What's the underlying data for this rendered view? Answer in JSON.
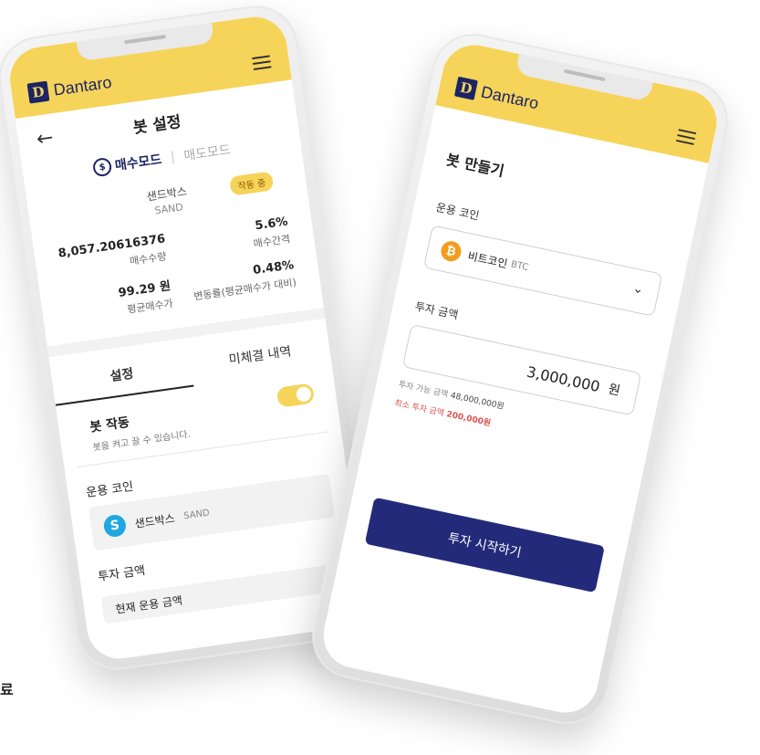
{
  "brand": {
    "name": "Dantaro",
    "mark": "D"
  },
  "left_phone": {
    "title": "봇 설정",
    "mode_active": "매수모드",
    "mode_inactive": "매도모드",
    "coin_name": "샌드박스",
    "coin_symbol": "SAND",
    "status_badge": "작동 중",
    "stats": [
      {
        "value": "8,057.20616376",
        "label": "매수수량"
      },
      {
        "value": "5.6%",
        "label": "매수간격"
      },
      {
        "value": "99.29 원",
        "label": "평균매수가"
      },
      {
        "value": "0.48%",
        "label": "변동률(평균매수가 대비)"
      }
    ],
    "tabs": [
      "설정",
      "미체결 내역"
    ],
    "bot_toggle_title": "봇 작동",
    "bot_toggle_desc": "봇을 켜고 끌 수 있습니다.",
    "bot_toggle_on": true,
    "coin_section_label": "운용 코인",
    "coin_select_name": "샌드박스",
    "coin_select_symbol": "SAND",
    "amount_section_label": "투자 금액",
    "amount_field_label": "현재 운용 금액"
  },
  "right_phone": {
    "title": "봇 만들기",
    "coin_label": "운용 코인",
    "coin_name": "비트코인",
    "coin_symbol": "BTC",
    "amount_label": "투자 금액",
    "amount_value": "3,000,000",
    "amount_unit": "원",
    "available_prefix": "투자 가능 금액",
    "available_value": "48,000,000원",
    "min_prefix": "최소 투자 금액",
    "min_value": "200,000원",
    "start_button": "투자 시작하기"
  },
  "cut_off_text": "료",
  "colors": {
    "brand_yellow": "#f6d45a",
    "brand_navy": "#1c2466",
    "button_navy": "#242a7a",
    "warning_red": "#e05050"
  }
}
